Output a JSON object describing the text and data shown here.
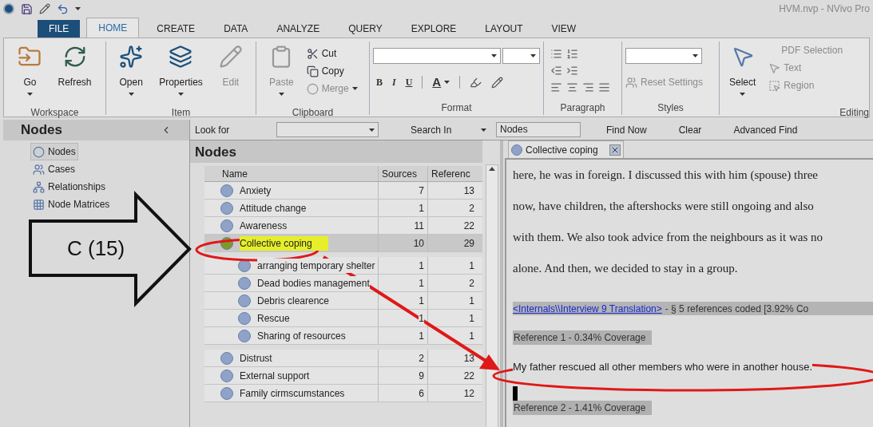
{
  "window": {
    "title": "HVM.nvp - NVivo Pro"
  },
  "ribbon_tabs": [
    {
      "label": "FILE",
      "kind": "file",
      "selected": false
    },
    {
      "label": "HOME",
      "kind": "tab",
      "selected": true
    },
    {
      "label": "CREATE",
      "kind": "tab",
      "selected": false
    },
    {
      "label": "DATA",
      "kind": "tab",
      "selected": false
    },
    {
      "label": "ANALYZE",
      "kind": "tab",
      "selected": false
    },
    {
      "label": "QUERY",
      "kind": "tab",
      "selected": false
    },
    {
      "label": "EXPLORE",
      "kind": "tab",
      "selected": false
    },
    {
      "label": "LAYOUT",
      "kind": "tab",
      "selected": false
    },
    {
      "label": "VIEW",
      "kind": "tab",
      "selected": false
    }
  ],
  "ribbon_groups": [
    {
      "kind": "large",
      "label": "Workspace",
      "buttons": [
        {
          "label": "Go",
          "dropdown": true,
          "disabled": false
        },
        {
          "label": "Refresh",
          "dropdown": false,
          "disabled": false
        }
      ]
    },
    {
      "kind": "large",
      "label": "Item",
      "buttons": [
        {
          "label": "Open",
          "dropdown": true,
          "disabled": false
        },
        {
          "label": "Properties",
          "dropdown": true,
          "disabled": false
        },
        {
          "label": "Edit",
          "dropdown": false,
          "disabled": true
        }
      ]
    },
    {
      "kind": "clipboard",
      "label": "Clipboard",
      "buttons": [
        {
          "label": "Paste",
          "dropdown": true,
          "disabled": true
        },
        {
          "label": "Cut",
          "dropdown": false,
          "disabled": false
        },
        {
          "label": "Copy",
          "dropdown": false,
          "disabled": false
        },
        {
          "label": "Merge",
          "dropdown": true,
          "disabled": true
        }
      ]
    },
    {
      "kind": "format",
      "label": "Format",
      "letters": [
        "B",
        "I",
        "U"
      ],
      "font_color": "A"
    },
    {
      "kind": "paragraph",
      "label": "Paragraph"
    },
    {
      "kind": "styles",
      "label": "Styles",
      "buttons": [
        {
          "label": "Reset Settings",
          "dropdown": false,
          "disabled": true
        }
      ]
    },
    {
      "kind": "editing",
      "label": "Editing",
      "buttons": [
        {
          "label": "Select",
          "dropdown": true,
          "disabled": false
        },
        {
          "label": "PDF Selection",
          "dropdown": false,
          "disabled": true
        },
        {
          "label": "Text",
          "dropdown": false,
          "disabled": true
        },
        {
          "label": "Region",
          "dropdown": false,
          "disabled": true
        }
      ]
    }
  ],
  "navigation": {
    "title": "Nodes",
    "items": [
      {
        "label": "Nodes",
        "selected": true
      },
      {
        "label": "Cases",
        "selected": false
      },
      {
        "label": "Relationships",
        "selected": false
      },
      {
        "label": "Node Matrices",
        "selected": false
      }
    ]
  },
  "find_bar": {
    "look_for_label": "Look for",
    "search_in_label": "Search In",
    "search_in_value": "Nodes",
    "buttons": [
      "Find Now",
      "Clear",
      "Advanced Find"
    ]
  },
  "node_list": {
    "title": "Nodes",
    "columns": [
      "Name",
      "Sources",
      "Referenc"
    ],
    "rows": [
      {
        "name": "Anxiety",
        "sources": "7",
        "references": "13",
        "selected": false,
        "highlighted": false,
        "expanded": false,
        "children": []
      },
      {
        "name": "Attitude change",
        "sources": "1",
        "references": "2",
        "selected": false,
        "highlighted": false,
        "expanded": false,
        "children": []
      },
      {
        "name": "Awareness",
        "sources": "11",
        "references": "22",
        "selected": false,
        "highlighted": false,
        "expanded": false,
        "children": []
      },
      {
        "name": "Collective coping",
        "sources": "10",
        "references": "29",
        "selected": true,
        "highlighted": true,
        "expanded": true,
        "children": [
          {
            "name": "arranging temporary shelter",
            "sources": "1",
            "references": "1"
          },
          {
            "name": "Dead bodies management",
            "sources": "1",
            "references": "2"
          },
          {
            "name": "Debris clearence",
            "sources": "1",
            "references": "1"
          },
          {
            "name": "Rescue",
            "sources": "1",
            "references": "1"
          },
          {
            "name": "Sharing of resources",
            "sources": "1",
            "references": "1"
          }
        ]
      },
      {
        "name": "Distrust",
        "sources": "2",
        "references": "13",
        "selected": false,
        "highlighted": false,
        "expanded": false,
        "children": []
      },
      {
        "name": "External support",
        "sources": "9",
        "references": "22",
        "selected": false,
        "highlighted": false,
        "expanded": false,
        "children": []
      },
      {
        "name": "Family cirmscumstances",
        "sources": "6",
        "references": "12",
        "selected": false,
        "highlighted": false,
        "expanded": false,
        "children": []
      }
    ]
  },
  "detail": {
    "tab": "Collective coping",
    "lines": [
      "here, he was in foreign. I discussed this with him (spouse) three",
      "now, have children, the aftershocks were still ongoing and also",
      "with them. We also took advice from the neighbours as it was no",
      "alone. And then, we decided to stay in a group."
    ],
    "source_link": "<Internals\\\\Interview 9 Translation>",
    "source_info": "- § 5 references coded  [3.92% Co",
    "references": [
      {
        "heading": "Reference 1 - 0.34% Coverage",
        "text": "My father rescued all other members who were in another house."
      },
      {
        "heading": "Reference 2 - 1.41% Coverage"
      }
    ]
  },
  "annotations": {
    "callout_label": "C (15)"
  }
}
